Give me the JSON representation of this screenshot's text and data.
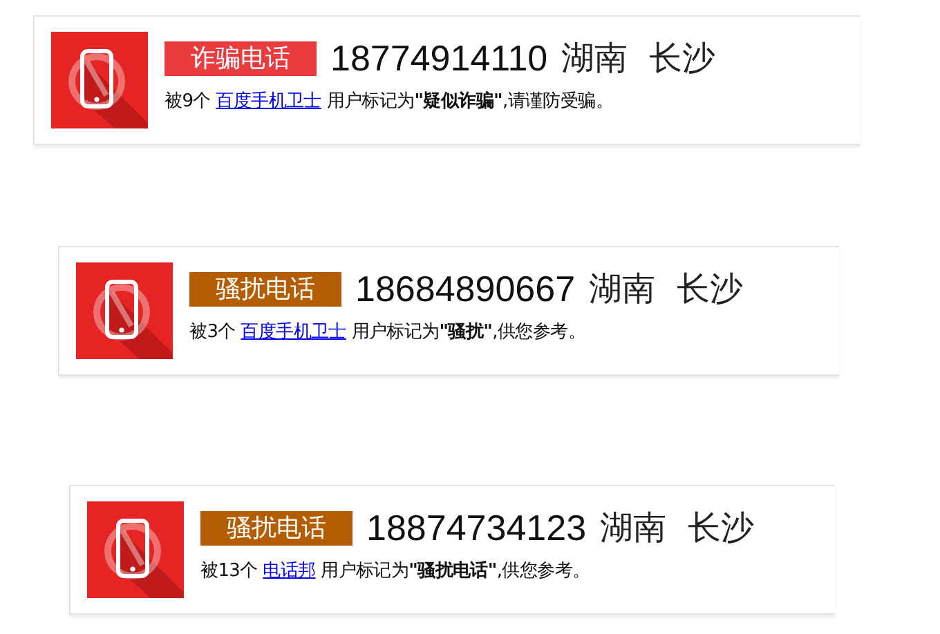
{
  "cards": [
    {
      "tag": "诈骗电话",
      "color": "#ea3b3f",
      "number": "18774914110",
      "province": "湖南",
      "city": "长沙",
      "prefix": "被9个",
      "link": "百度手机卫士",
      "suffix": "用户标记为**\"疑似诈骗\"**,请谨防受骗。"
    },
    {
      "tag": "骚扰电话",
      "color": "#b45c00",
      "number": "18684890667",
      "province": "湖南",
      "city": "长沙",
      "prefix": "被3个",
      "link": "百度手机卫士",
      "suffix": "用户标记为**\"骚扰\"**,供您参考。"
    },
    {
      "tag": "骚扰电话",
      "color": "#b45c00",
      "number": "18874734123",
      "province": "湖南",
      "city": "长沙",
      "prefix": "被13个",
      "link": "电话邦",
      "suffix": "用户标记为**\"骚扰电话\"**,供您参考。"
    }
  ]
}
